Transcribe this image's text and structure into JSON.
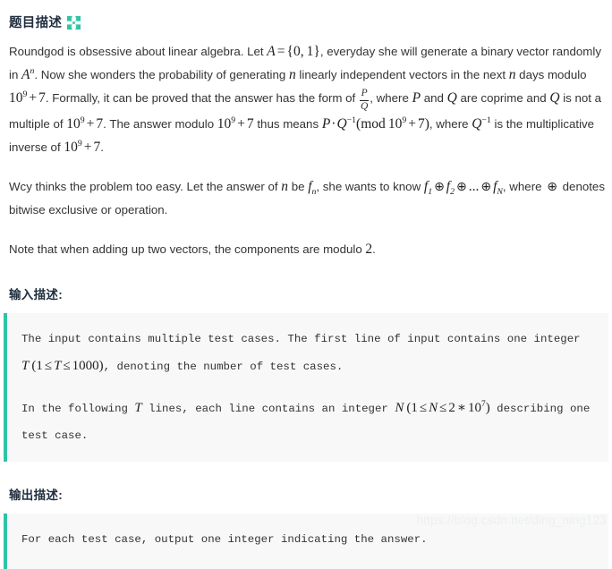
{
  "header": {
    "title": "题目描述",
    "expand_icon": "expand-arrows-icon",
    "icon_color": "#2ec4a6"
  },
  "description": {
    "p1": {
      "t1": "Roundgod is obsessive about linear algebra. Let ",
      "m1": "A = {0, 1}",
      "t2": ", everyday she will generate a binary vector randomly in ",
      "m2": "A^n",
      "t3": ". Now she wonders the probability of generating ",
      "m3": "n",
      "t4": " linearly independent vectors in the next ",
      "m4": "n",
      "t5": " days modulo ",
      "m5": "10^9 + 7",
      "t6": ". Formally, it can be proved that the answer has the form of ",
      "m6_num": "P",
      "m6_den": "Q",
      "t7": ", where ",
      "m7": "P",
      "t8": " and ",
      "m8": "Q",
      "t9": " are coprime and ",
      "m9": "Q",
      "t10": " is not a multiple of ",
      "m10": "10^9 + 7",
      "t11": ". The answer modulo ",
      "m11": "10^9 + 7",
      "t12": " thus means ",
      "m12": "P · Q^-1 (mod 10^9 + 7)",
      "t13": ", where ",
      "m13": "Q^-1",
      "t14": " is the multiplicative inverse of ",
      "m14": "10^9 + 7",
      "t15": "."
    },
    "p2": {
      "t1": "Wcy thinks the problem too easy. Let the answer of ",
      "m1": "n",
      "t2": " be ",
      "m2": "f_n",
      "t3": ", she wants to know ",
      "m3": "f_1 ⊕ f_2 ⊕ ... ⊕ f_N",
      "t4": ", where ",
      "m4": "⊕",
      "t5": " denotes bitwise exclusive or operation."
    },
    "p3": {
      "t1": "Note that when adding up two vectors, the components are modulo ",
      "m1": "2",
      "t2": "."
    }
  },
  "input_section": {
    "heading": "输入描述:",
    "line1_a": "The input contains multiple test cases. The first line of input contains one integer ",
    "line1_m": "T (1 ≤ T ≤ 1000)",
    "line1_b": ", denoting the number of test cases.",
    "line2_a": "In the following ",
    "line2_m1": "T",
    "line2_b": " lines, each line contains an integer ",
    "line2_m2": "N (1 ≤ N ≤ 2 * 10^7)",
    "line2_c": " describing one test case."
  },
  "output_section": {
    "heading": "输出描述:",
    "line1": "For each test case, output one integer indicating the answer."
  },
  "watermark": {
    "text": "https://blog.csdn.net/ding_ning123"
  }
}
